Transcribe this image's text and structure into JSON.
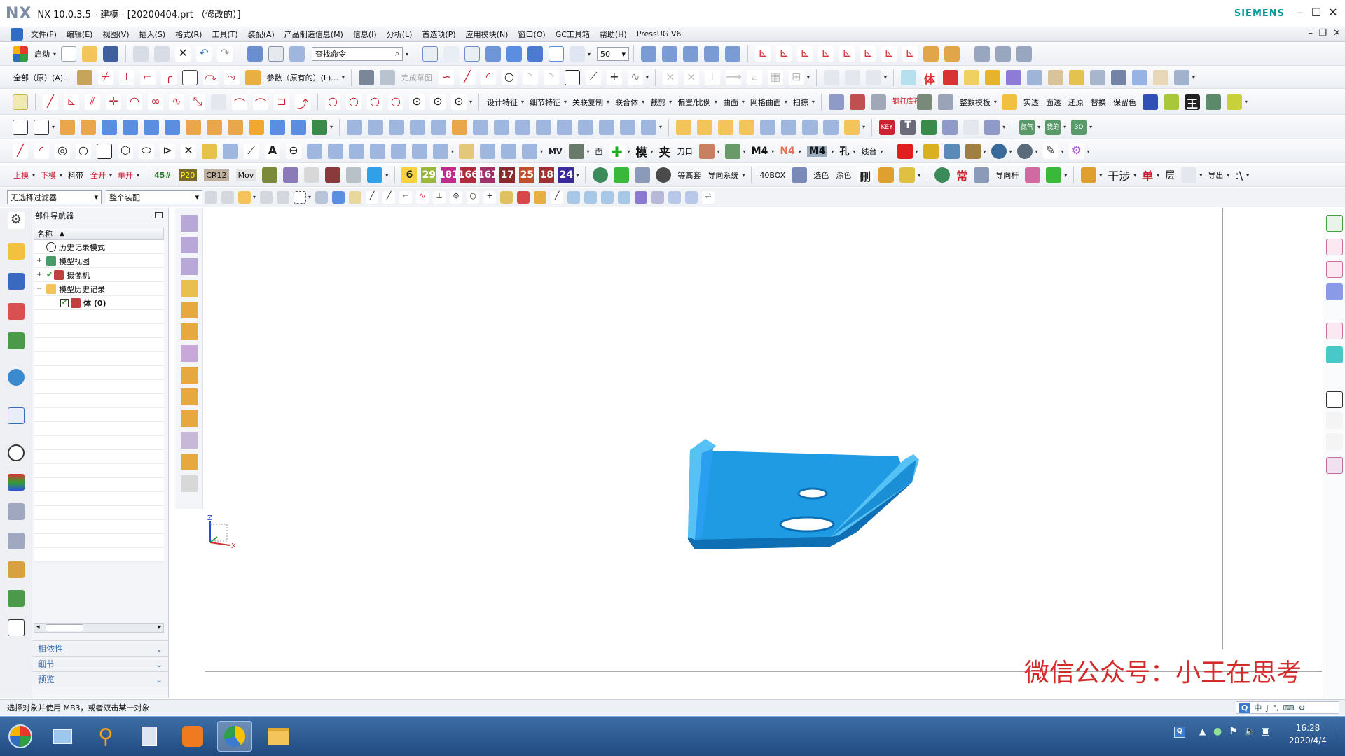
{
  "title": {
    "brand": "NX",
    "text": "NX 10.0.3.5 - 建模 - [20200404.prt （修改的）]",
    "vendor": "SIEMENS"
  },
  "menu": {
    "items": [
      "文件(F)",
      "编辑(E)",
      "视图(V)",
      "插入(S)",
      "格式(R)",
      "工具(T)",
      "装配(A)",
      "产品制造信息(M)",
      "信息(I)",
      "分析(L)",
      "首选项(P)",
      "应用模块(N)",
      "窗口(O)",
      "GC工具箱",
      "帮助(H)",
      "PressUG V6"
    ]
  },
  "toolbar1": {
    "start_label": "启动",
    "command_search_placeholder": "查找命令",
    "zoom_value": "50"
  },
  "toolbar2": {
    "scope_label": "全部（原）(A)...",
    "params_label": "参数（原有的）(L)...",
    "sketch_done_label": "完成草图"
  },
  "toolbar3": {
    "menus": [
      "设计特征",
      "细节特征",
      "关联复制",
      "联合体",
      "裁剪",
      "偏置/比例",
      "曲面",
      "网格曲面",
      "扫掠"
    ],
    "labels": [
      "钢打底孔",
      "整数模板",
      "实透",
      "面透",
      "还原",
      "替换",
      "保留色"
    ]
  },
  "toolbar4": {
    "labels": [
      "MV",
      "面",
      "模",
      "夹",
      "刀口",
      "M4",
      "N4",
      "M4",
      "孔",
      "线台"
    ]
  },
  "toolbar5": {
    "labels": [
      "上模",
      "下模",
      "料带",
      "全开",
      "单开",
      "45#",
      "P20",
      "CR12",
      "Mov",
      "等高套",
      "导向系统",
      "40BOX",
      "选色",
      "涂色",
      "常",
      "导向杆",
      "干涉",
      "单",
      "层",
      "导出"
    ],
    "numbers": [
      "6",
      "29",
      "181",
      "166",
      "161",
      "17",
      "25",
      "18",
      "24"
    ]
  },
  "filters": {
    "selection_filter": "无选择过滤器",
    "scope": "整个装配"
  },
  "navigator": {
    "title": "部件导航器",
    "column_name": "名称",
    "nodes": [
      {
        "label": "历史记录模式",
        "expander": ""
      },
      {
        "label": "模型视图",
        "expander": "+"
      },
      {
        "label": "摄像机",
        "expander": "+"
      },
      {
        "label": "模型历史记录",
        "expander": "−"
      },
      {
        "label": "体 (0)",
        "expander": ""
      }
    ],
    "sections": [
      "相依性",
      "细节",
      "预览"
    ]
  },
  "status": {
    "message": "选择对象并使用 MB3，或者双击某一对象"
  },
  "watermark": "微信公众号：小王在思考",
  "axes": {
    "z": "Z",
    "x": "X"
  },
  "ime": [
    "中",
    "J",
    "°,",
    "⌨",
    "⚙"
  ],
  "tray": {
    "time": "16:28",
    "date": "2020/4/4"
  },
  "colors": {
    "part_fill": "#1e9be3",
    "part_dark": "#0f6fb5",
    "part_light": "#56c1f5",
    "accent": "#009999"
  }
}
